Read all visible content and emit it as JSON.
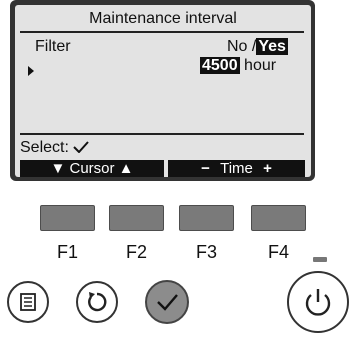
{
  "screen": {
    "title": "Maintenance interval",
    "filter_label": "Filter",
    "option_no": "No",
    "option_sep": "/",
    "option_yes": "Yes",
    "interval_value": "4500",
    "interval_unit": "hour",
    "select_label": "Select:"
  },
  "function_bar": {
    "cursor_label": "Cursor",
    "time_label": "Time"
  },
  "function_keys": [
    "F1",
    "F2",
    "F3",
    "F4"
  ],
  "buttons": {
    "menu_icon": "menu-icon",
    "return_icon": "return-icon",
    "select_icon": "check-icon",
    "power_icon": "power-icon"
  },
  "colors": {
    "screen_bg": "#e3e3e3",
    "frame": "#333333",
    "key_fill": "#7a7a7a",
    "select_button": "#8c8c8c"
  }
}
